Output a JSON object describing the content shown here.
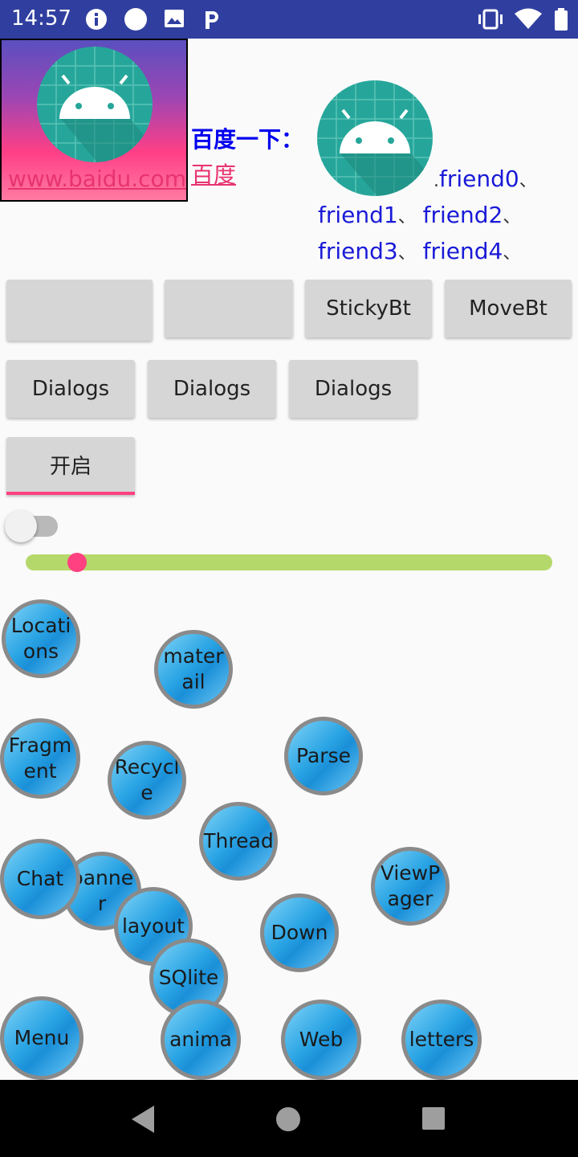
{
  "status_bar": {
    "time": "14:57",
    "icons_left": [
      "info-icon",
      "circle-icon",
      "image-icon",
      "parking-icon"
    ],
    "icons_right": [
      "vibrate-icon",
      "wifi-icon",
      "battery-icon"
    ]
  },
  "header": {
    "hero_link": "www.baidu.com",
    "baidu_title": "百度一下：",
    "baidu_link": "百度",
    "friends": [
      "friend0",
      "friend1",
      "friend2",
      "friend3",
      "friend4"
    ],
    "friend_prefix": ".",
    "friend_separator": "、"
  },
  "buttons_row1": [
    "",
    "",
    "StickyBt",
    "MoveBt"
  ],
  "buttons_row2": [
    "Dialogs",
    "Dialogs",
    "Dialogs"
  ],
  "toggle_button": "开启",
  "switch": {
    "on": false
  },
  "slider": {
    "value": 0.08,
    "track_color": "#b5d86b",
    "thumb_color": "#ff4081"
  },
  "bubbles": [
    "Locations",
    "materail",
    "Fragment",
    "Recycle",
    "Parse",
    "Thread",
    "Chat",
    "banner",
    "layout",
    "ViewPager",
    "Down",
    "SQlite",
    "Menu",
    "anima",
    "Web",
    "letters"
  ],
  "colors": {
    "status_bar": "#303f9f",
    "accent": "#ff4081",
    "link": "#e8336f"
  }
}
